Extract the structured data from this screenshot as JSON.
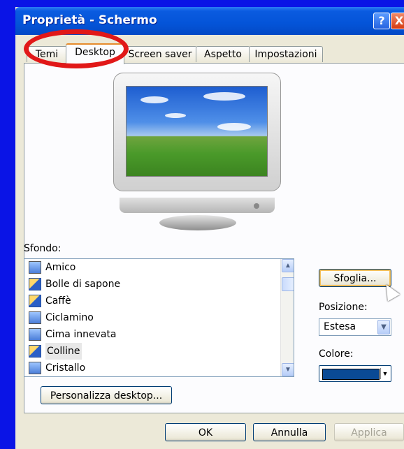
{
  "window": {
    "title": "Proprietà - Schermo"
  },
  "titlebar_buttons": {
    "help": "?",
    "close": "X"
  },
  "tabs": [
    {
      "label": "Temi"
    },
    {
      "label": "Desktop"
    },
    {
      "label": "Screen saver"
    },
    {
      "label": "Aspetto"
    },
    {
      "label": "Impostazioni"
    }
  ],
  "active_tab": "Desktop",
  "background": {
    "label": "Sfondo:",
    "items": [
      {
        "label": "Amico",
        "icon": "image-icon"
      },
      {
        "label": "Bolle di sapone",
        "icon": "brush-icon"
      },
      {
        "label": "Caffè",
        "icon": "brush-icon"
      },
      {
        "label": "Ciclamino",
        "icon": "image-icon"
      },
      {
        "label": "Cima innevata",
        "icon": "image-icon"
      },
      {
        "label": "Colline",
        "icon": "brush-icon",
        "selected": true
      },
      {
        "label": "Cristallo",
        "icon": "image-icon"
      }
    ]
  },
  "browse_button": "Sfoglia...",
  "position": {
    "label": "Posizione:",
    "value": "Estesa"
  },
  "color": {
    "label": "Colore:",
    "value": "#0a4a95"
  },
  "customize_button": "Personalizza desktop...",
  "footer": {
    "ok": "OK",
    "cancel": "Annulla",
    "apply": "Applica"
  }
}
